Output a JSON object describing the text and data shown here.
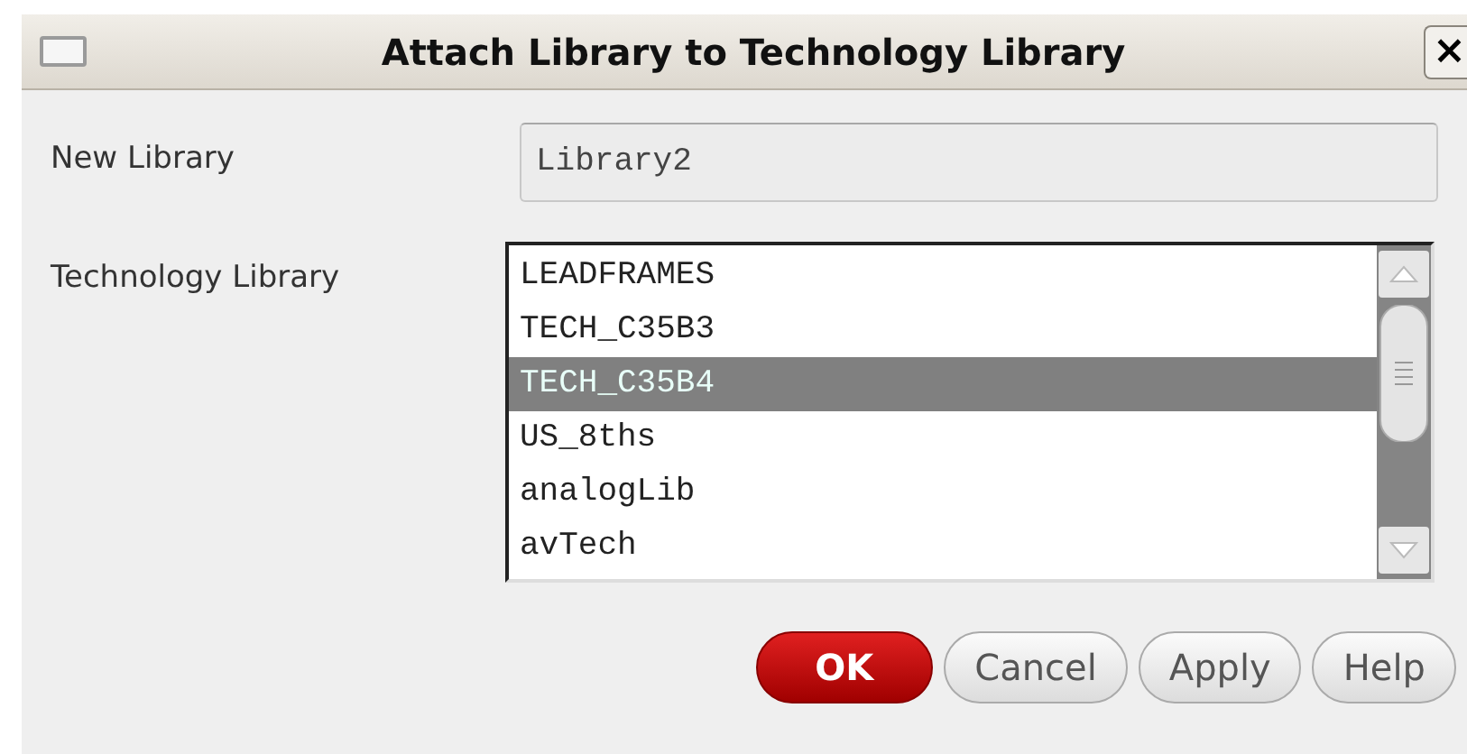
{
  "window": {
    "title": "Attach Library to Technology Library",
    "close_glyph": "×"
  },
  "fields": [
    {
      "label": "New Library",
      "value": "Library2"
    }
  ],
  "technology_library": {
    "label": "Technology Library",
    "items": [
      {
        "name": "LEADFRAMES",
        "selected": false
      },
      {
        "name": "TECH_C35B3",
        "selected": false
      },
      {
        "name": "TECH_C35B4",
        "selected": true
      },
      {
        "name": "US_8ths",
        "selected": false
      },
      {
        "name": "analogLib",
        "selected": false
      },
      {
        "name": "avTech",
        "selected": false
      }
    ]
  },
  "buttons": [
    {
      "label": "OK",
      "kind": "default"
    },
    {
      "label": "Cancel",
      "kind": "normal"
    },
    {
      "label": "Apply",
      "kind": "normal"
    },
    {
      "label": "Help",
      "kind": "normal"
    }
  ]
}
